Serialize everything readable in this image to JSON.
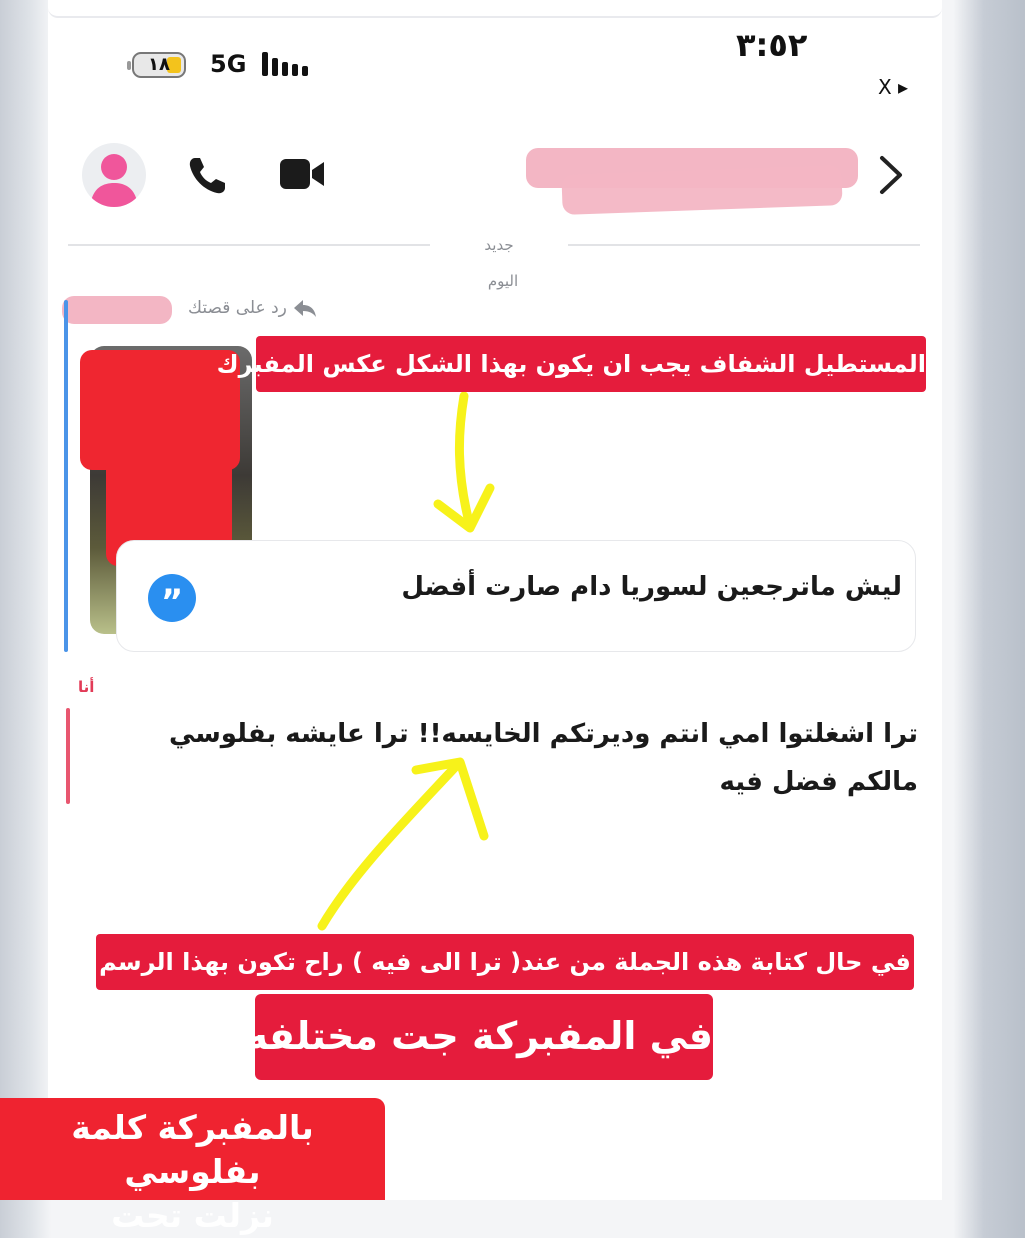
{
  "status_bar": {
    "time": "٣:٥٢",
    "battery_level": "١٨",
    "network": "5G",
    "forward_label": "X ▸"
  },
  "conversation": {
    "new_divider": "جديد",
    "day_divider": "اليوم",
    "reply_meta": "رد على قصتك",
    "quoted_reply": "ليش ماترجعين لسوريا دام صارت أفضل",
    "me_label": "أنا",
    "my_message_line1": "ترا اشغلتوا امي انتم وديرتكم الخايسه!! ترا عايشه بفلوسي",
    "my_message_line2": "مالكم فضل فيه"
  },
  "annotations": {
    "top_note": "المستطيل الشفاف يجب ان يكون بهذا الشكل عكس المفبرك",
    "bottom_note": "في حال كتابة هذه الجملة من عند( ترا الى فيه ) راح تكون بهذا الرسم",
    "big_note": "في المفبركة جت مختلفه",
    "corner_note_line1": "بالمفبركة كلمة بفلوسي",
    "corner_note_line2": "نزلت تحت"
  },
  "colors": {
    "annotation_red": "#e51c3c",
    "arrow_yellow": "#f7f21a",
    "quote_bar_blue": "#4b94e8",
    "me_bar_pink": "#e8566f",
    "redaction_pink": "#f3b6c4"
  },
  "icons": [
    "profile-avatar-icon",
    "phone-icon",
    "video-camera-icon",
    "chevron-right-icon",
    "reply-arrow-icon",
    "quote-icon"
  ]
}
